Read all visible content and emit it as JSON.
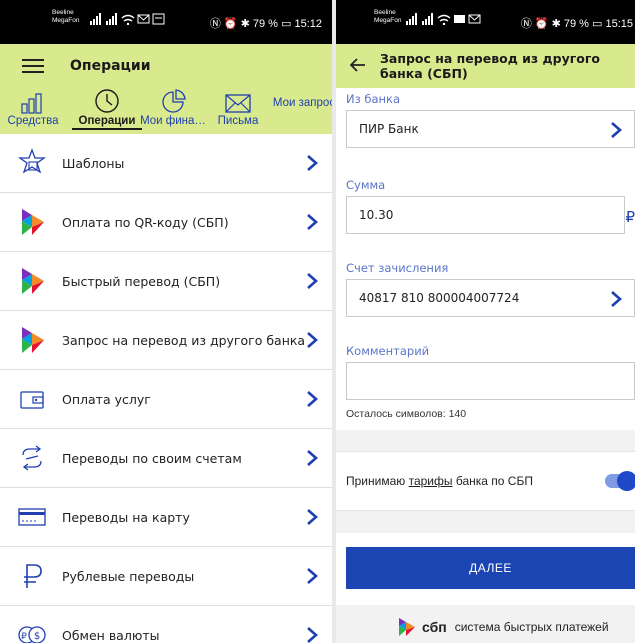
{
  "left": {
    "status": {
      "carrier1": "Beeline",
      "carrier2": "MegaFon",
      "icons": "…… …",
      "right": "Ⓝ ⏰ ✱ 79 % ▭ 15:12"
    },
    "header": {
      "title": "Операции"
    },
    "tabs": [
      {
        "label": "Средства",
        "icon": "bar-chart-icon"
      },
      {
        "label": "Операции",
        "icon": "clock-icon",
        "active": true
      },
      {
        "label": "Мои фина…",
        "icon": "pie-chart-icon"
      },
      {
        "label": "Письма",
        "icon": "envelope-icon"
      },
      {
        "label": "Мои запрос",
        "icon": ""
      }
    ],
    "menu": [
      {
        "label": "Шаблоны",
        "icon": "puzzle-star-icon"
      },
      {
        "label": "Оплата по QR-коду (СБП)",
        "icon": "sbp-logo-icon"
      },
      {
        "label": "Быстрый перевод (СБП)",
        "icon": "sbp-logo-icon"
      },
      {
        "label": "Запрос на перевод из другого банка",
        "icon": "sbp-logo-icon"
      },
      {
        "label": "Оплата услуг",
        "icon": "wallet-icon"
      },
      {
        "label": "Переводы по своим счетам",
        "icon": "transfer-arrows-icon"
      },
      {
        "label": "Переводы на карту",
        "icon": "card-icon"
      },
      {
        "label": "Рублевые переводы",
        "icon": "ruble-icon"
      },
      {
        "label": "Обмен валюты",
        "icon": "currency-exchange-icon"
      }
    ]
  },
  "right": {
    "status": {
      "carrier1": "Beeline",
      "carrier2": "MegaFon",
      "right": "Ⓝ ⏰ ✱ 79 % ▭ 15:15"
    },
    "header": {
      "title": "Запрос на перевод из другого банка (СБП)"
    },
    "bank": {
      "label": "Из банка",
      "value": "ПИР Банк"
    },
    "amount": {
      "label": "Сумма",
      "value": "10.30",
      "currency": "₽"
    },
    "account": {
      "label": "Счет зачисления",
      "value": "40817 810 800004007724"
    },
    "comment": {
      "label": "Комментарий",
      "value": "",
      "counter": "Осталось символов: 140"
    },
    "terms": {
      "prefix": "Принимаю ",
      "link": "тарифы",
      "suffix": " банка по СБП",
      "enabled": true
    },
    "next_button": "ДАЛЕЕ",
    "footer": {
      "brand": "сбп",
      "text": "система быстрых платежей"
    }
  },
  "colors": {
    "header_bg": "#d9ea8e",
    "accent": "#1c45b4",
    "tab_text": "#1f3fb0"
  }
}
